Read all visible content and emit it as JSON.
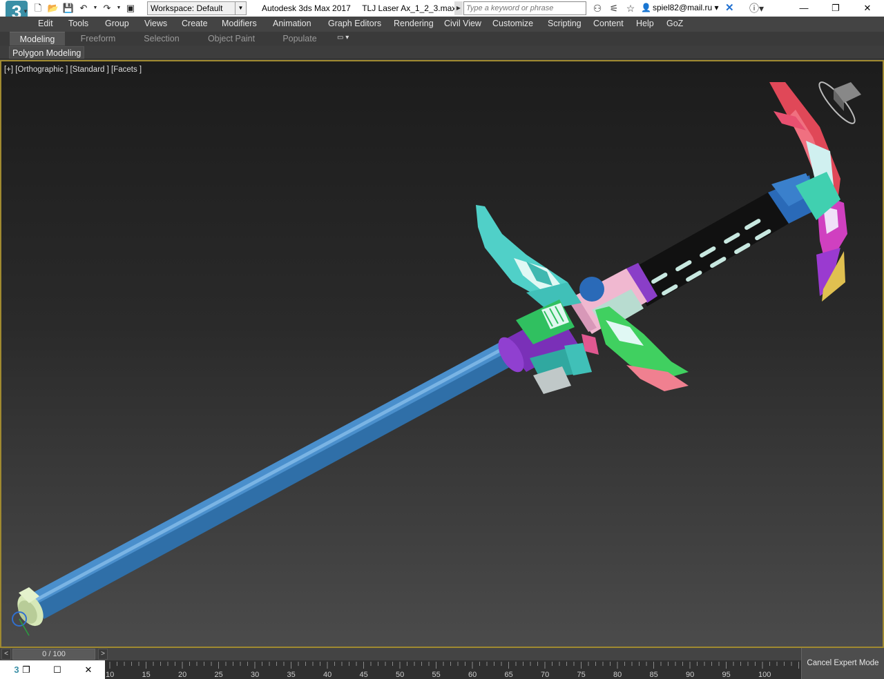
{
  "titlebar": {
    "logo_text": "3",
    "workspace_label": "Workspace: Default",
    "window_title": "Autodesk 3ds Max 2017     TLJ Laser Ax_1_2_3.max",
    "search_placeholder": "Type a keyword or phrase",
    "user": "spiel82@mail.ru",
    "icons": [
      "new-file-icon",
      "open-icon",
      "save-icon",
      "undo-icon",
      "redo-icon",
      "project-icon"
    ]
  },
  "menu": {
    "items": [
      "Edit",
      "Tools",
      "Group",
      "Views",
      "Create",
      "Modifiers",
      "Animation",
      "Graph Editors",
      "Rendering",
      "Civil View",
      "Customize",
      "Scripting",
      "Content",
      "Help",
      "GoZ"
    ]
  },
  "ribbon": {
    "tabs": [
      "Modeling",
      "Freeform",
      "Selection",
      "Object Paint",
      "Populate"
    ],
    "active_tab": "Modeling",
    "panel_label": "Polygon Modeling"
  },
  "viewport": {
    "label": "[+] [Orthographic ] [Standard ] [Facets ]",
    "border_color": "#a08a30"
  },
  "timeline": {
    "slider_text": "0 / 100",
    "prev": "<",
    "next": ">",
    "ticks": [
      "10",
      "15",
      "20",
      "25",
      "30",
      "35",
      "40",
      "45",
      "50",
      "55",
      "60",
      "65",
      "70",
      "75",
      "80",
      "85",
      "90",
      "95",
      "100"
    ]
  },
  "statusbar": {
    "expert_button": "Cancel Expert Mode"
  }
}
